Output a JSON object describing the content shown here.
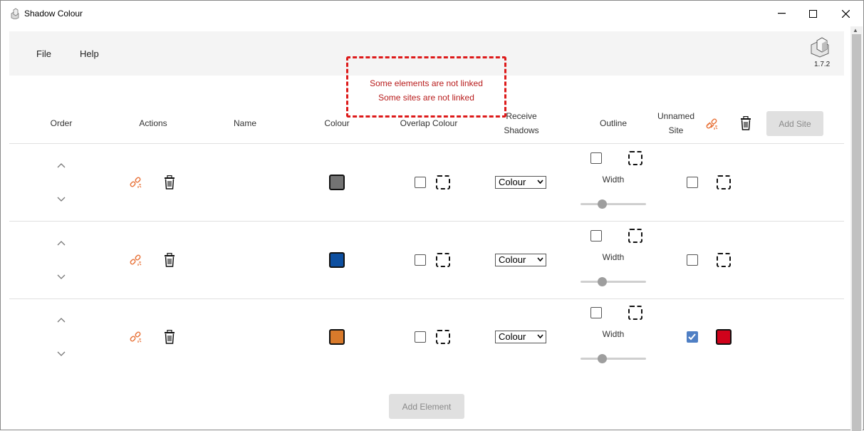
{
  "window": {
    "title": "Shadow Colour",
    "min_glyph": "—",
    "max_glyph": "☐",
    "close_glyph": "✕"
  },
  "menu": {
    "file": "File",
    "help": "Help"
  },
  "version": "1.7.2",
  "notice": {
    "line1": "Some elements are not linked",
    "line2": "Some sites are not linked"
  },
  "headers": {
    "order": "Order",
    "actions": "Actions",
    "name": "Name",
    "colour": "Colour",
    "overlap_colour": "Overlap Colour",
    "receive_line1": "Receive",
    "receive_line2": "Shadows",
    "outline": "Outline",
    "site_line1": "Unnamed",
    "site_line2": "Site",
    "add_site": "Add Site"
  },
  "rows": [
    {
      "colour": "#737373",
      "receive": "Colour",
      "width_label": "Width",
      "width_value": 0.33,
      "site_checked": false,
      "site_colour": null
    },
    {
      "colour": "#0d4fa0",
      "receive": "Colour",
      "width_label": "Width",
      "width_value": 0.33,
      "site_checked": false,
      "site_colour": null
    },
    {
      "colour": "#d97a2b",
      "receive": "Colour",
      "width_label": "Width",
      "width_value": 0.33,
      "site_checked": true,
      "site_colour": "#d0021b"
    }
  ],
  "add_element": "Add Element",
  "colors": {
    "accent_link": "#e8743b",
    "notice_border": "#dd1a1a",
    "notice_text": "#b81c1c",
    "check": "#4f7fc4"
  }
}
